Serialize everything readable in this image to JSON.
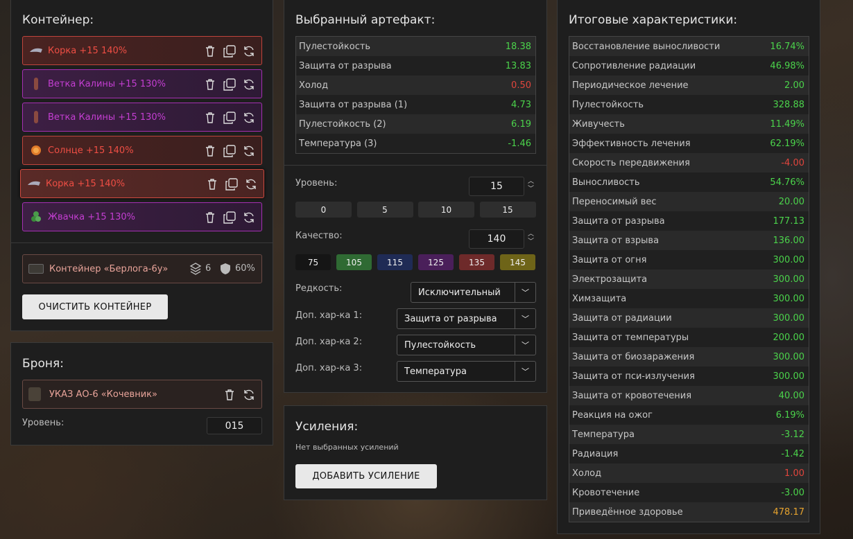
{
  "container": {
    "title": "Контейнер:",
    "slots": [
      {
        "name": "Корка +15 140%",
        "tone": "red",
        "icon": "bark-icon"
      },
      {
        "name": "Ветка Калины +15 130%",
        "tone": "pur",
        "icon": "branch-icon"
      },
      {
        "name": "Ветка Калины +15 130%",
        "tone": "pur",
        "icon": "branch-icon"
      },
      {
        "name": "Солнце +15 140%",
        "tone": "red",
        "icon": "sun-icon"
      },
      {
        "name": "Корка +15 140%",
        "tone": "red",
        "icon": "bark-icon",
        "selected": true
      },
      {
        "name": "Жвачка +15 130%",
        "tone": "pur",
        "icon": "gum-icon"
      }
    ],
    "info": {
      "name": "Контейнер «Берлога-6у»",
      "slots": "6",
      "protection": "60%"
    },
    "clear_label": "ОЧИСТИТЬ КОНТЕЙНЕР"
  },
  "armor": {
    "title": "Броня:",
    "name": "УКАЗ АО-6 «Кочевник»",
    "level_label": "Уровень:",
    "level": "015"
  },
  "artifact": {
    "title": "Выбранный артефакт:",
    "stats": [
      {
        "k": "Пулестойкость",
        "v": "18.38",
        "c": "g"
      },
      {
        "k": "Защита от разрыва",
        "v": "13.83",
        "c": "g"
      },
      {
        "k": "Холод",
        "v": "0.50",
        "c": "r"
      },
      {
        "k": "Защита от разрыва (1)",
        "v": "4.73",
        "c": "g"
      },
      {
        "k": "Пулестойкость (2)",
        "v": "6.19",
        "c": "g"
      },
      {
        "k": "Температура (3)",
        "v": "-1.46",
        "c": "g"
      }
    ],
    "level_label": "Уровень:",
    "level": "15",
    "level_presets": [
      "0",
      "5",
      "10",
      "15"
    ],
    "quality_label": "Качество:",
    "quality": "140",
    "quality_presets": [
      {
        "v": "75",
        "color": "#151515"
      },
      {
        "v": "105",
        "color": "#2f6a33"
      },
      {
        "v": "115",
        "color": "#1f2b55"
      },
      {
        "v": "125",
        "color": "#4a1f5a"
      },
      {
        "v": "135",
        "color": "#6e2a2a"
      },
      {
        "v": "145",
        "color": "#6e6418"
      }
    ],
    "rarity_label": "Редкость:",
    "rarity": "Исключительный",
    "extra": [
      {
        "label": "Доп. хар-ка 1:",
        "value": "Защита от разрыва"
      },
      {
        "label": "Доп. хар-ка 2:",
        "value": "Пулестойкость"
      },
      {
        "label": "Доп. хар-ка 3:",
        "value": "Температура"
      }
    ]
  },
  "boosts": {
    "title": "Усиления:",
    "empty": "Нет выбранных усилений",
    "add_label": "ДОБАВИТЬ УСИЛЕНИЕ"
  },
  "totals": {
    "title": "Итоговые характеристики:",
    "stats": [
      {
        "k": "Восстановление выносливости",
        "v": "16.74%",
        "c": "g"
      },
      {
        "k": "Сопротивление радиации",
        "v": "46.98%",
        "c": "g"
      },
      {
        "k": "Периодическое лечение",
        "v": "2.00",
        "c": "g"
      },
      {
        "k": "Пулестойкость",
        "v": "328.88",
        "c": "g"
      },
      {
        "k": "Живучесть",
        "v": "11.49%",
        "c": "g"
      },
      {
        "k": "Эффективность лечения",
        "v": "62.19%",
        "c": "g"
      },
      {
        "k": "Скорость передвижения",
        "v": "-4.00",
        "c": "r"
      },
      {
        "k": "Выносливость",
        "v": "54.76%",
        "c": "g"
      },
      {
        "k": "Переносимый вес",
        "v": "20.00",
        "c": "g"
      },
      {
        "k": "Защита от разрыва",
        "v": "177.13",
        "c": "g"
      },
      {
        "k": "Защита от взрыва",
        "v": "136.00",
        "c": "g"
      },
      {
        "k": "Защита от огня",
        "v": "300.00",
        "c": "g"
      },
      {
        "k": "Электрозащита",
        "v": "300.00",
        "c": "g"
      },
      {
        "k": "Химзащита",
        "v": "300.00",
        "c": "g"
      },
      {
        "k": "Защита от радиации",
        "v": "300.00",
        "c": "g"
      },
      {
        "k": "Защита от температуры",
        "v": "200.00",
        "c": "g"
      },
      {
        "k": "Защита от биозаражения",
        "v": "300.00",
        "c": "g"
      },
      {
        "k": "Защита от пси-излучения",
        "v": "300.00",
        "c": "g"
      },
      {
        "k": "Защита от кровотечения",
        "v": "40.00",
        "c": "g"
      },
      {
        "k": "Реакция на ожог",
        "v": "6.19%",
        "c": "g"
      },
      {
        "k": "Температура",
        "v": "-3.12",
        "c": "g"
      },
      {
        "k": "Радиация",
        "v": "-1.42",
        "c": "g"
      },
      {
        "k": "Холод",
        "v": "1.00",
        "c": "r"
      },
      {
        "k": "Кровотечение",
        "v": "-3.00",
        "c": "g"
      },
      {
        "k": "Приведённое здоровье",
        "v": "478.17",
        "c": "o"
      }
    ]
  }
}
